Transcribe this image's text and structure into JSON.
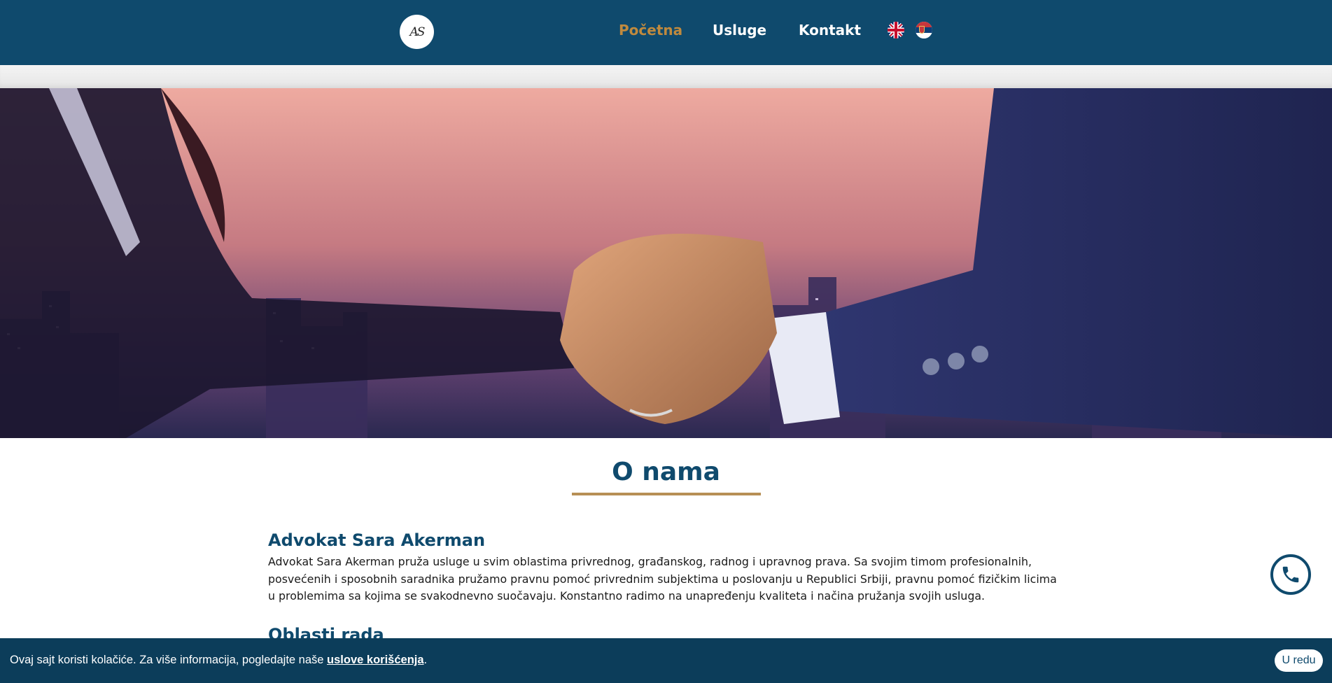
{
  "header": {
    "logo_text": "AS",
    "nav": [
      {
        "label": "Početna",
        "active": true
      },
      {
        "label": "Usluge",
        "active": false
      },
      {
        "label": "Kontakt",
        "active": false
      }
    ],
    "languages": [
      {
        "icon": "uk-flag-icon",
        "code": "en"
      },
      {
        "icon": "serbia-flag-icon",
        "code": "sr"
      }
    ]
  },
  "hero": {
    "icon": "handshake-city-image"
  },
  "about": {
    "title": "O nama",
    "heading": "Advokat Sara Akerman",
    "paragraph": "Advokat Sara Akerman pruža usluge u svim oblastima privrednog, građanskog, radnog i upravnog prava. Sa svojim timom profesionalnih, posvećenih i sposobnih saradnika pružamo pravnu pomoć privrednim subjektima u poslovanju u Republici Srbiji, pravnu pomoć fizičkim licima u problemima sa kojima se svakodnevno suočavaju. Konstantno radimo na unapređenju kvaliteta i načina pružanja svojih usluga.",
    "heading_2": "Oblasti rada"
  },
  "phone_button": {
    "icon": "phone-icon"
  },
  "cookie": {
    "text": "Ovaj sajt koristi kolačiće. Za više informacija, pogledajte naše ",
    "link": "uslove korišćenja",
    "suffix": ".",
    "button": "U redu"
  },
  "colors": {
    "primary": "#0f4a6d",
    "accent": "#c08a3e",
    "underline": "#b78f55",
    "cookie_bg": "#0c3d5a"
  }
}
